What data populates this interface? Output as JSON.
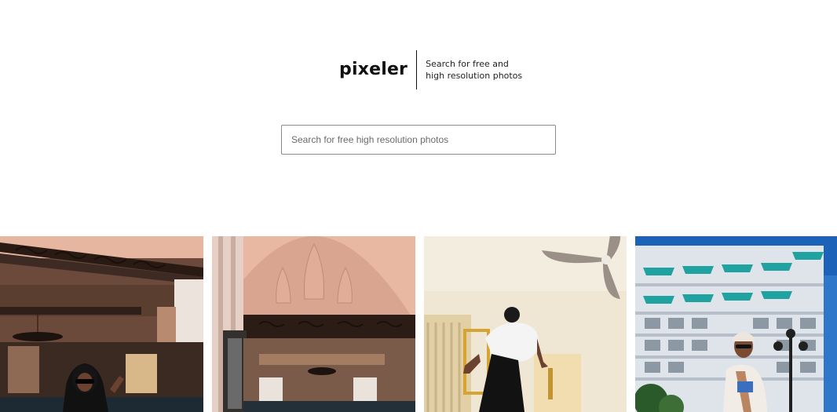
{
  "brand": {
    "logo": "pixeler",
    "tagline_line1": "Search for free and",
    "tagline_line2": "high resolution photos"
  },
  "search": {
    "placeholder": "Search for free high resolution photos",
    "value": ""
  },
  "gallery": {
    "photos": [
      {
        "subject": "man in hooded black jacket and sunglasses in ornate lobby"
      },
      {
        "subject": "arched ceiling lobby with person seated"
      },
      {
        "subject": "person jumping near ceiling fan"
      },
      {
        "subject": "man in cap in front of white hotel building with blue sky"
      }
    ]
  }
}
